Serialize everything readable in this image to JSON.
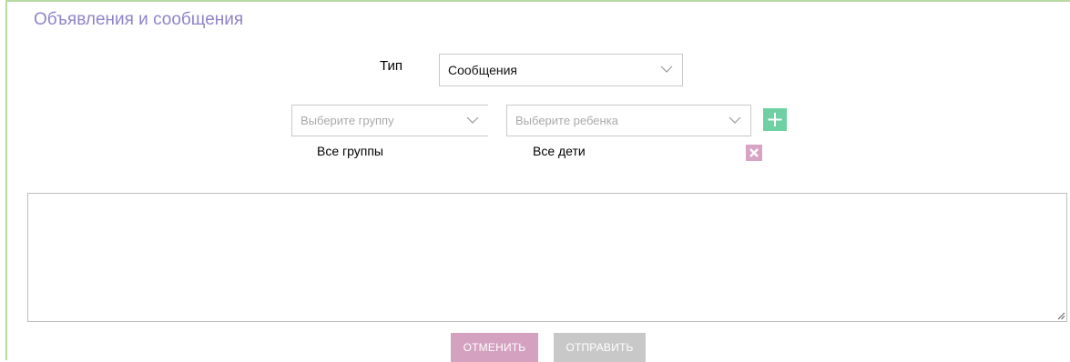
{
  "page": {
    "title": "Объявления и сообщения"
  },
  "form": {
    "type_label": "Тип",
    "type_select": {
      "value": "Сообщения",
      "icon": "chevron-down-icon"
    },
    "group_select": {
      "placeholder": "Выберите группу",
      "icon": "chevron-down-icon"
    },
    "child_select": {
      "placeholder": "Выберите ребенка",
      "icon": "chevron-down-icon"
    },
    "add_button": {
      "icon": "plus-icon"
    },
    "remove_button": {
      "icon": "close-icon"
    },
    "selected_group": "Все группы",
    "selected_child": "Все дети",
    "message": {
      "value": ""
    }
  },
  "actions": {
    "cancel_label": "ОТМЕНИТЬ",
    "send_label": "ОТПРАВИТЬ"
  },
  "colors": {
    "title": "#8f84c9",
    "panel_border": "#b7d9a4",
    "add_button": "#6fd0a4",
    "remove_button": "#d9a3c4",
    "cancel_button": "#d4a1c0",
    "send_button": "#c8c8c8"
  }
}
